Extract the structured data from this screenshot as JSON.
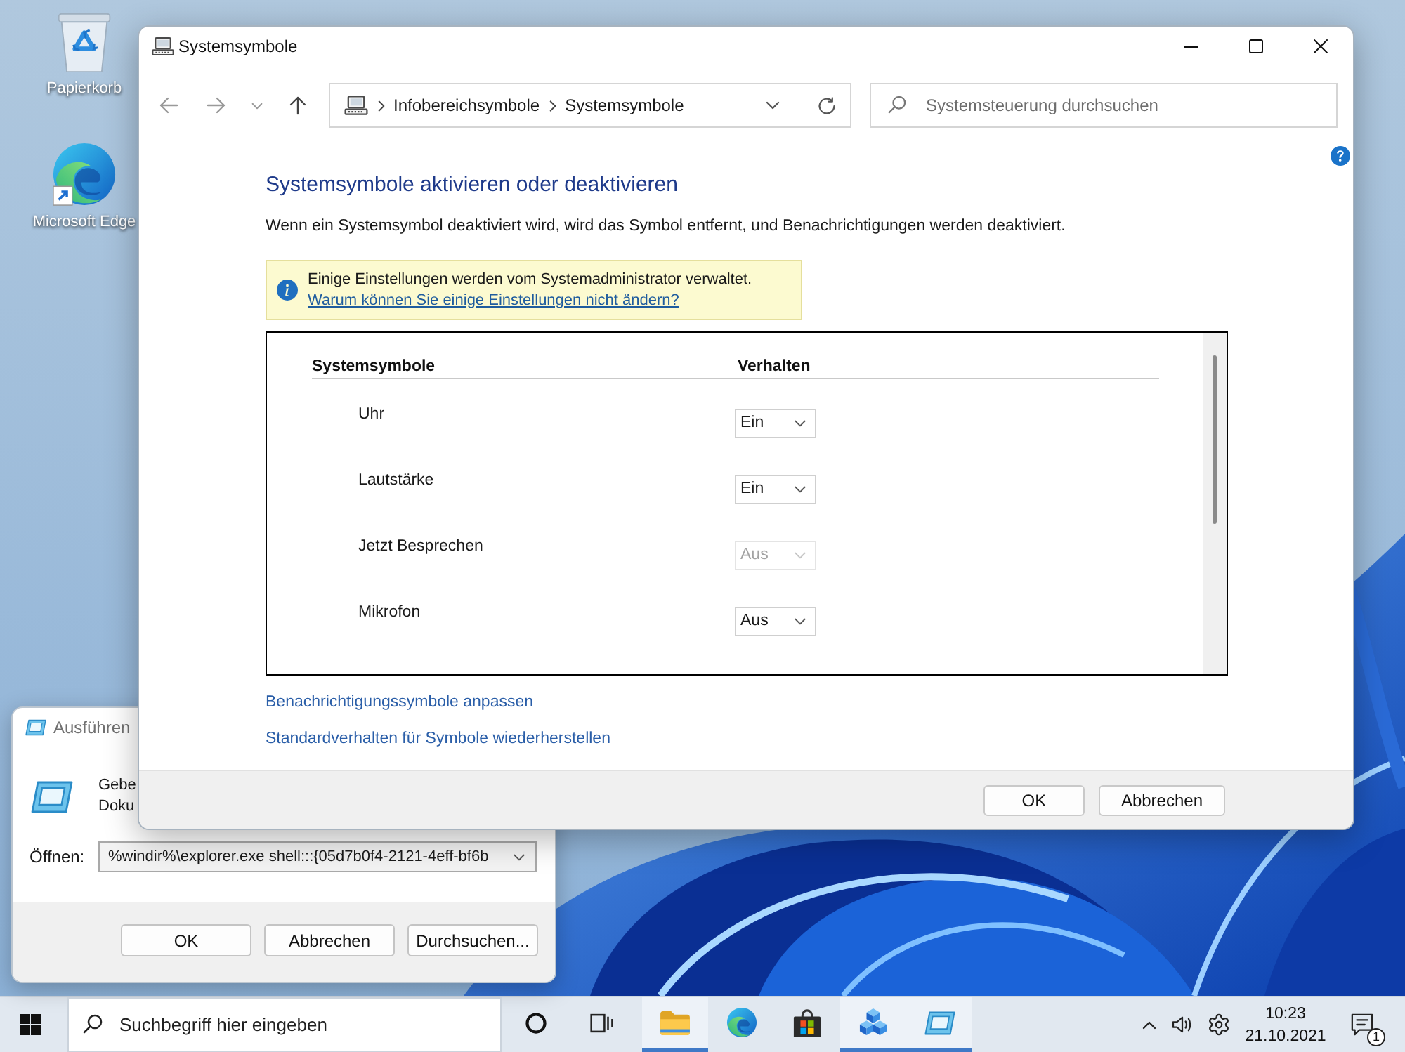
{
  "desktop": {
    "icons": [
      {
        "kind": "recycle_bin",
        "label": "Papierkorb"
      },
      {
        "kind": "browser",
        "label": "Microsoft Edge"
      }
    ]
  },
  "window": {
    "title": "Systemsymbole",
    "address": [
      "Infobereichsymbole",
      "Systemsymbole"
    ],
    "search": {
      "placeholder": "Systemsteuerung durchsuchen"
    },
    "heading": "Systemsymbole aktivieren oder deaktivieren",
    "description": "Wenn ein Systemsymbol deaktiviert wird, wird das Symbol entfernt, und Benachrichtigungen werden deaktiviert.",
    "notice": {
      "text": "Einige Einstellungen werden vom Systemadministrator verwaltet.",
      "link": "Warum können Sie einige Einstellungen nicht ändern?"
    },
    "table": {
      "columns": [
        "Systemsymbole",
        "Verhalten"
      ],
      "rows": [
        {
          "name": "Uhr",
          "behavior": "Ein",
          "disabled": false
        },
        {
          "name": "Lautstärke",
          "behavior": "Ein",
          "disabled": false
        },
        {
          "name": "Jetzt Besprechen",
          "behavior": "Aus",
          "disabled": true
        },
        {
          "name": "Mikrofon",
          "behavior": "Aus",
          "disabled": false
        }
      ]
    },
    "links": [
      "Benachrichtigungssymbole anpassen",
      "Standardverhalten für Symbole wiederherstellen"
    ],
    "buttons": [
      "OK",
      "Abbrechen"
    ]
  },
  "run_dialog": {
    "title": "Ausführen",
    "prompt": [
      "Gebe",
      "Doku"
    ],
    "open_label": "Öffnen:",
    "open_value": "%windir%\\explorer.exe shell:::{05d7b0f4-2121-4eff-bf6b",
    "buttons": [
      "OK",
      "Abbrechen",
      "Durchsuchen..."
    ]
  },
  "taskbar": {
    "search": {
      "placeholder": "Suchbegriff hier eingeben"
    },
    "apps": [
      {
        "kind": "cortana",
        "active": false
      },
      {
        "kind": "task_view",
        "active": false
      },
      {
        "kind": "file_explorer",
        "active": true
      },
      {
        "kind": "browser",
        "active": false
      },
      {
        "kind": "store",
        "active": false
      },
      {
        "kind": "cubes",
        "active": true
      },
      {
        "kind": "run",
        "active": true
      }
    ],
    "tray": {
      "time": "10:23",
      "date": "21.10.2021",
      "notification_count": "1"
    }
  }
}
